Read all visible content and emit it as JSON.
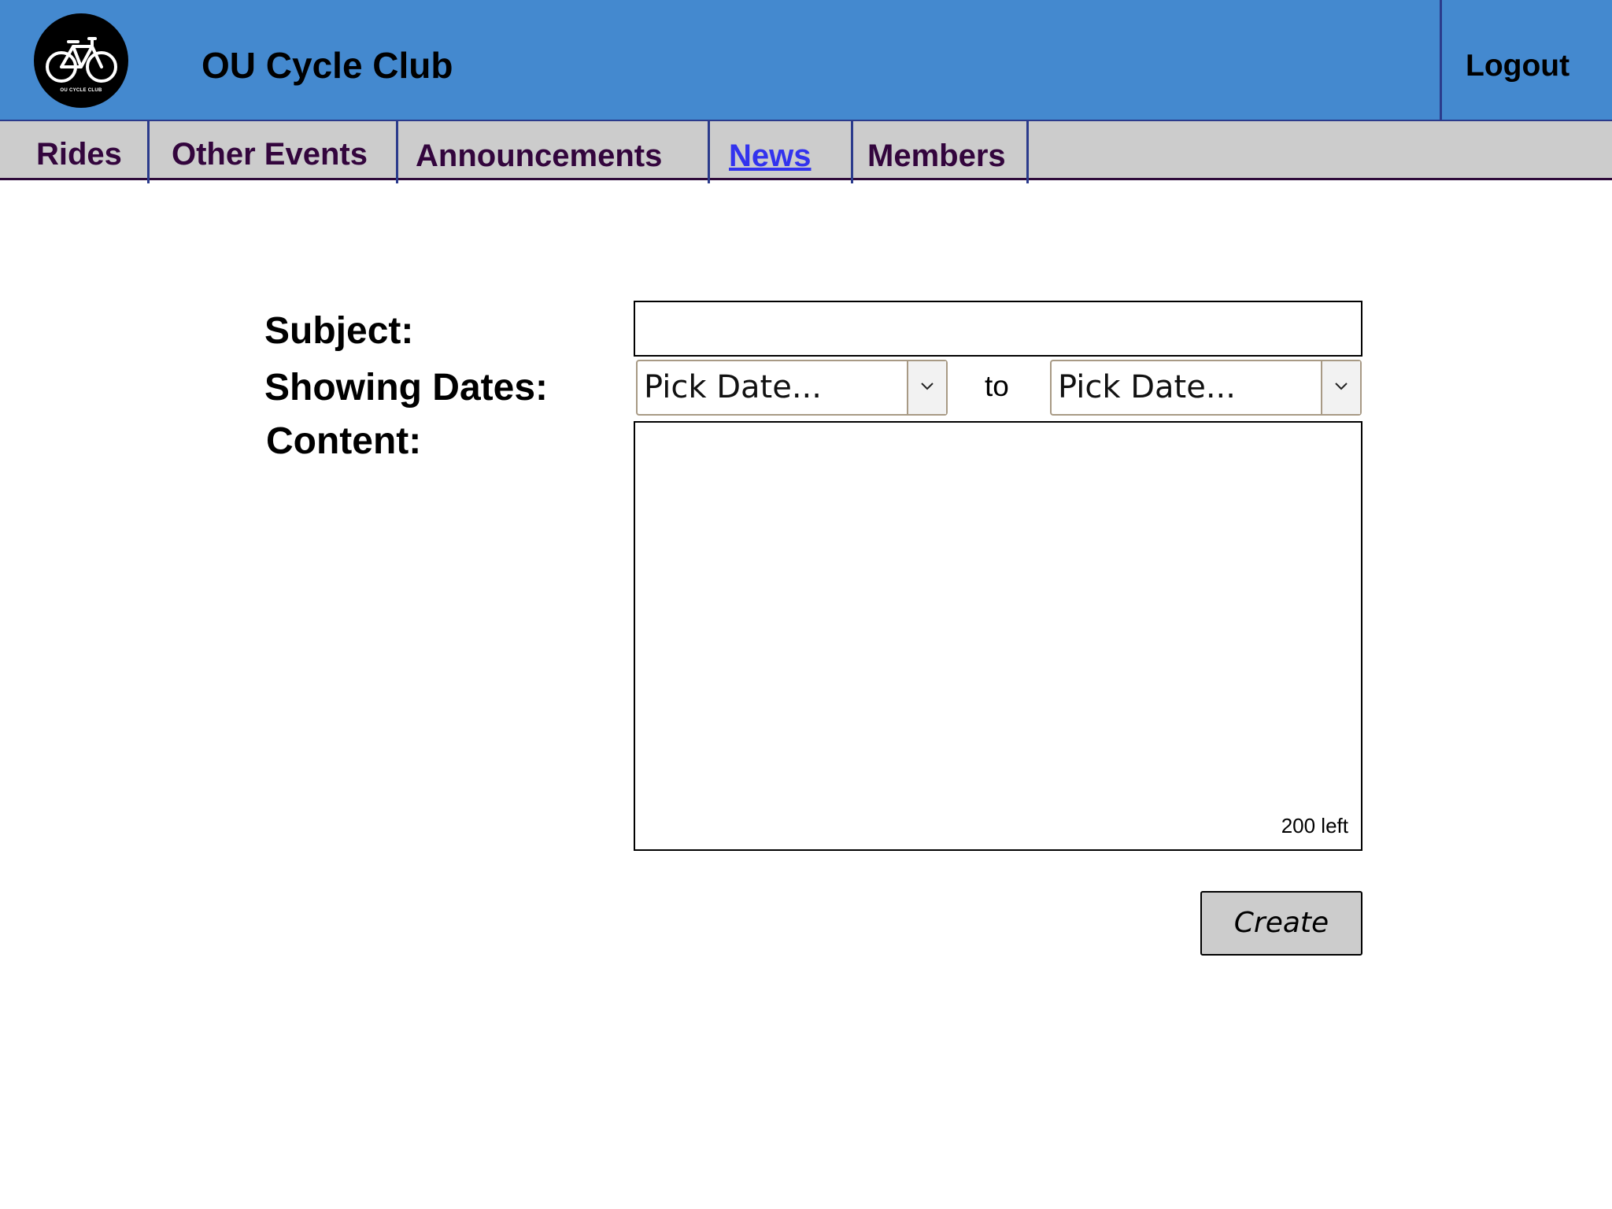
{
  "header": {
    "logo_text": "OU CYCLE CLUB",
    "title": "OU Cycle Club",
    "logout_label": "Logout"
  },
  "nav": {
    "tabs": [
      {
        "label": "Rides"
      },
      {
        "label": "Other Events"
      },
      {
        "label": "Announcements"
      },
      {
        "label": "News",
        "active": true
      },
      {
        "label": "Members"
      }
    ]
  },
  "form": {
    "subject_label": "Subject:",
    "subject_value": "",
    "dates_label": "Showing Dates:",
    "start_date_placeholder": "Pick Date...",
    "to_label": "to",
    "end_date_placeholder": "Pick Date...",
    "content_label": "Content:",
    "content_value": "",
    "chars_left": "200 left",
    "create_label": "Create"
  },
  "colors": {
    "header_bg": "#4489cf",
    "nav_bg": "#cccccc",
    "nav_text": "#33053d",
    "active_link": "#3333ee"
  }
}
